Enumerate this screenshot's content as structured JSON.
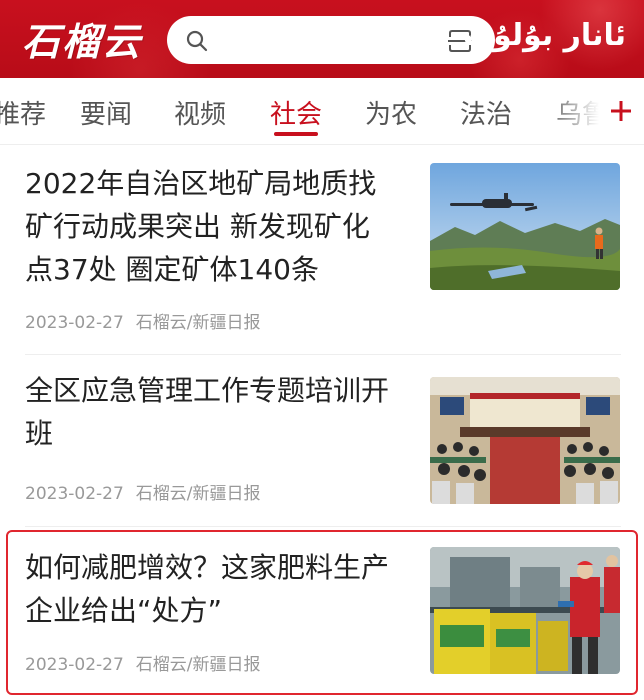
{
  "header": {
    "logo_text": "石榴云",
    "search_placeholder": "",
    "uyghur_title": "ئانار بۇلۇت"
  },
  "tabs": [
    {
      "label": "推荐"
    },
    {
      "label": "要闻"
    },
    {
      "label": "视频"
    },
    {
      "label": "社会",
      "active": true
    },
    {
      "label": "为农"
    },
    {
      "label": "法治"
    },
    {
      "label": "乌鲁"
    }
  ],
  "news": [
    {
      "title": "2022年自治区地矿局地质找矿行动成果突出 新发现矿化点37处 圈定矿体140条",
      "date": "2023-02-27",
      "source": "石榴云/新疆日报",
      "image": "drone-over-mountains"
    },
    {
      "title": "全区应急管理工作专题培训开班",
      "date": "2023-02-27",
      "source": "石榴云/新疆日报",
      "image": "conference-hall"
    },
    {
      "title": "如何减肥增效？这家肥料生产企业给出“处方”",
      "date": "2023-02-27",
      "source": "石榴云/新疆日报",
      "image": "fertilizer-factory"
    }
  ],
  "colors": {
    "brand_red": "#c8101e",
    "highlight_border": "#e0262f",
    "meta_gray": "#999999"
  }
}
